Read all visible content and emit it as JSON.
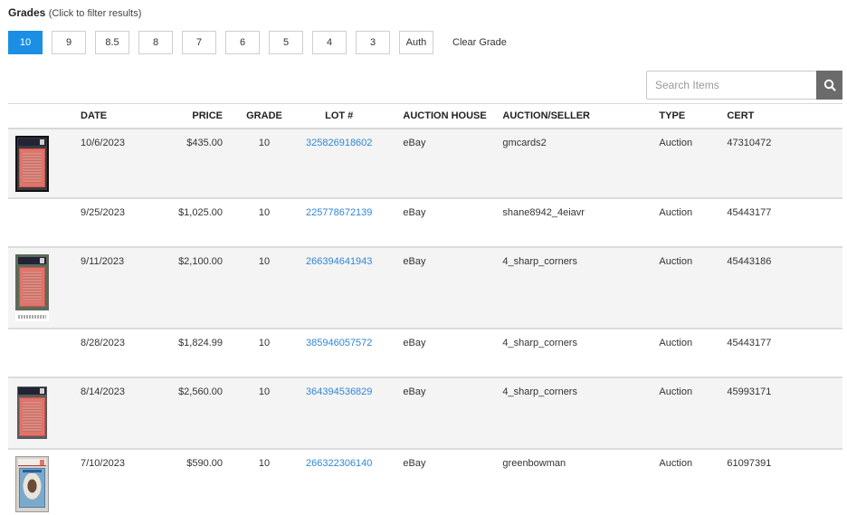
{
  "grades": {
    "title": "Grades",
    "hint": "(Click to filter results)",
    "buttons": [
      "10",
      "9",
      "8.5",
      "8",
      "7",
      "6",
      "5",
      "4",
      "3",
      "Auth"
    ],
    "active": "10",
    "clear_label": "Clear Grade",
    "active_color": "#1a8fe3"
  },
  "search": {
    "placeholder": "Search Items",
    "value": "",
    "icon": "search-icon"
  },
  "table": {
    "columns": [
      "",
      "DATE",
      "PRICE",
      "GRADE",
      "LOT #",
      "AUCTION HOUSE",
      "AUCTION/SELLER",
      "TYPE",
      "CERT"
    ],
    "link_color": "#2f86d6",
    "rows": [
      {
        "has_image": true,
        "date": "10/6/2023",
        "price": "$435.00",
        "grade": "10",
        "lot": "325826918602",
        "house": "eBay",
        "seller": "gmcards2",
        "type": "Auction",
        "cert": "47310472"
      },
      {
        "has_image": false,
        "date": "9/25/2023",
        "price": "$1,025.00",
        "grade": "10",
        "lot": "225778672139",
        "house": "eBay",
        "seller": "shane8942_4eiavr",
        "type": "Auction",
        "cert": "45443177"
      },
      {
        "has_image": true,
        "date": "9/11/2023",
        "price": "$2,100.00",
        "grade": "10",
        "lot": "266394641943",
        "house": "eBay",
        "seller": "4_sharp_corners",
        "type": "Auction",
        "cert": "45443186"
      },
      {
        "has_image": false,
        "date": "8/28/2023",
        "price": "$1,824.99",
        "grade": "10",
        "lot": "385946057572",
        "house": "eBay",
        "seller": "4_sharp_corners",
        "type": "Auction",
        "cert": "45443177"
      },
      {
        "has_image": true,
        "date": "8/14/2023",
        "price": "$2,560.00",
        "grade": "10",
        "lot": "364394536829",
        "house": "eBay",
        "seller": "4_sharp_corners",
        "type": "Auction",
        "cert": "45993171"
      },
      {
        "has_image": true,
        "date": "7/10/2023",
        "price": "$590.00",
        "grade": "10",
        "lot": "266322306140",
        "house": "eBay",
        "seller": "greenbowman",
        "type": "Auction",
        "cert": "61097391"
      }
    ]
  }
}
